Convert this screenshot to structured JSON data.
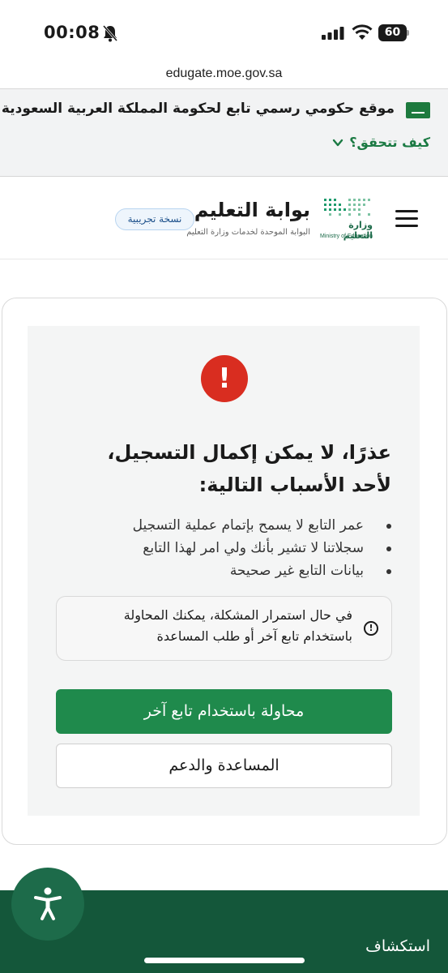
{
  "status_bar": {
    "time": "00:08",
    "battery": "60",
    "icons": [
      "bell-slash-icon",
      "signal-icon",
      "wifi-icon",
      "battery-icon"
    ]
  },
  "browser": {
    "url": "edugate.moe.gov.sa"
  },
  "gov_banner": {
    "text": "موقع حكومي رسمي تابع لحكومة المملكة العربية السعودية",
    "verify_label": "كيف تتحقق؟"
  },
  "header": {
    "ministry_ar": "وزارة التعليم",
    "ministry_en": "Ministry of Education",
    "brand_title": "بوابة التعليم",
    "brand_subtitle": "البوابة الموحدة لخدمات وزارة التعليم",
    "beta_badge": "نسخة تجريبية"
  },
  "error": {
    "title": "عذرًا، لا يمكن إكمال التسجيل، لأحد الأسباب التالية:",
    "reasons": [
      "عمر التابع لا يسمح بإتمام عملية التسجيل",
      "سجلاتنا لا تشير بأنك ولي امر لهذا التابع",
      "بيانات التابع غير صحيحة"
    ],
    "info": "في حال استمرار المشكلة، يمكنك المحاولة باستخدام تابع آخر أو طلب المساعدة",
    "primary_button": "محاولة باستخدام تابع آخر",
    "secondary_button": "المساعدة والدعم"
  },
  "footer": {
    "label": "استكشاف"
  },
  "colors": {
    "primary_green": "#1f8a4c",
    "footer_green": "#14573a",
    "error_red": "#d92d20"
  }
}
